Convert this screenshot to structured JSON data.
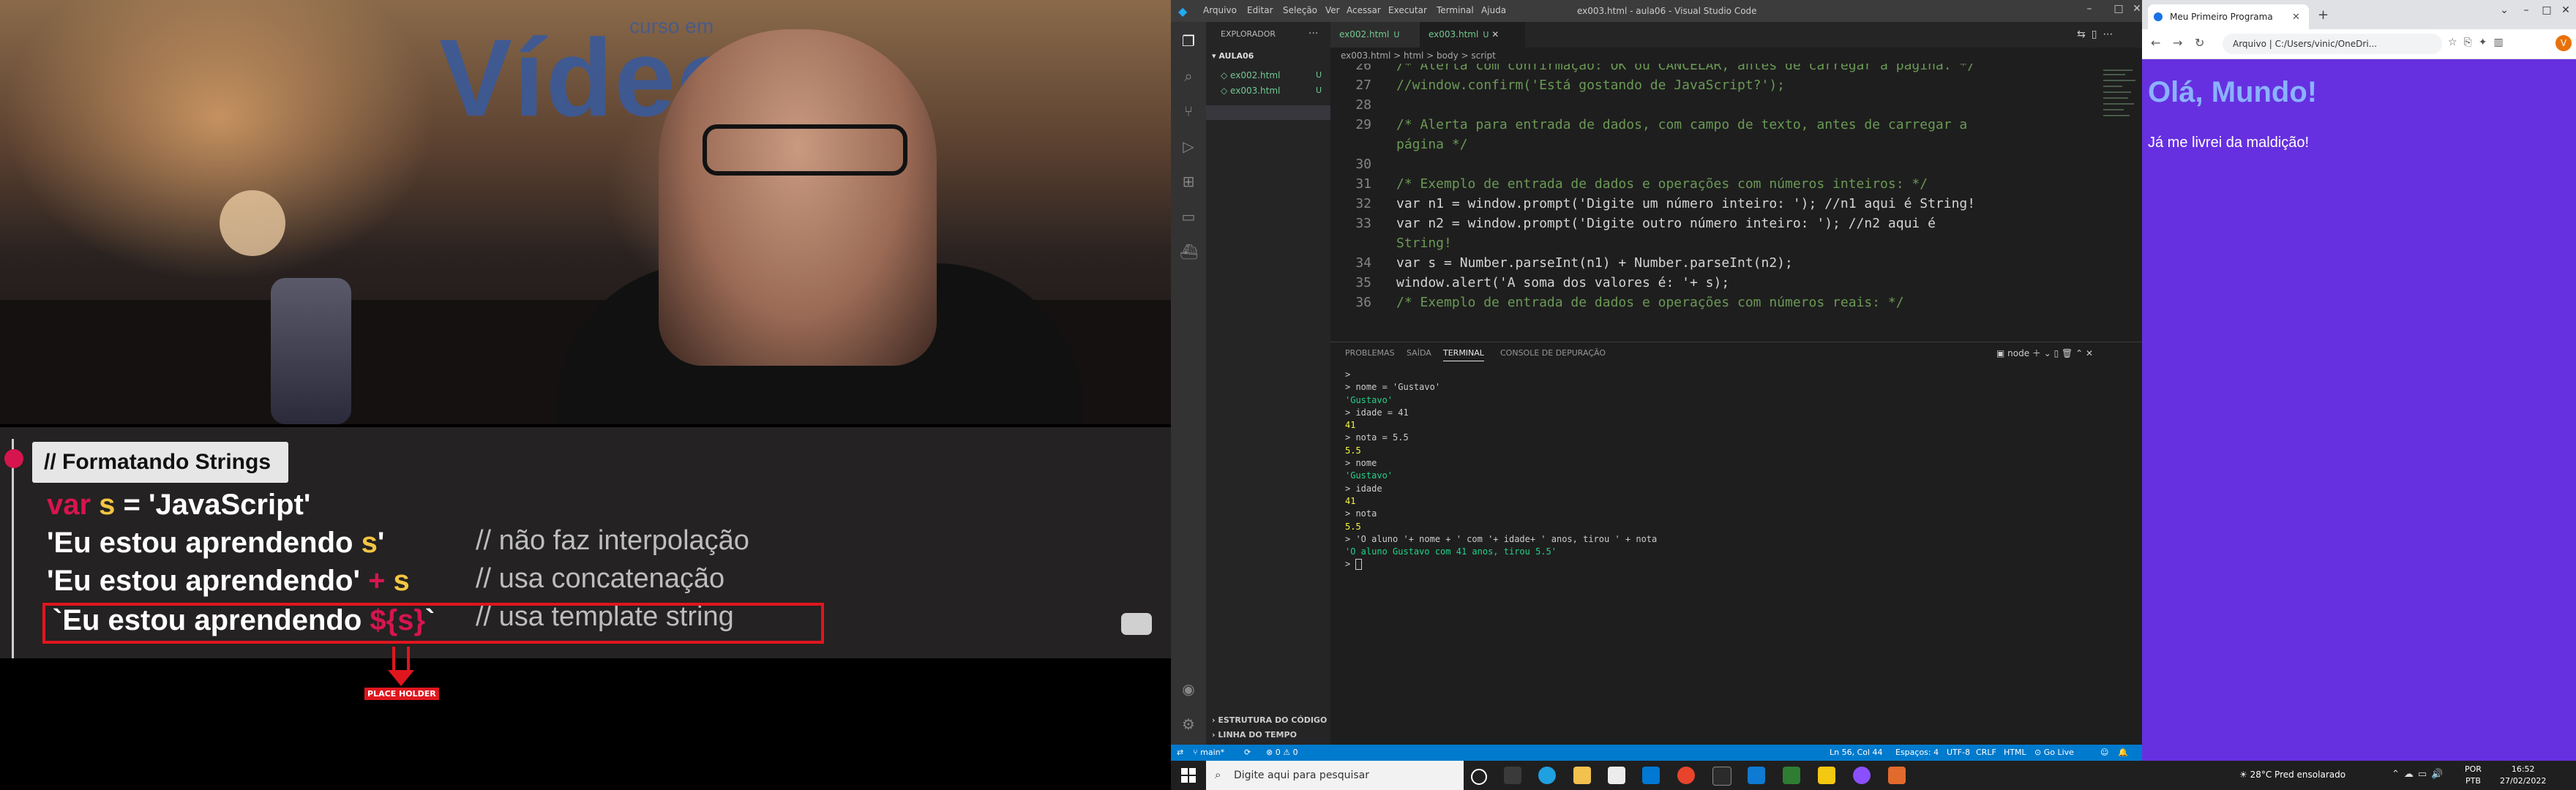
{
  "video": {
    "brand_main": "Vídeo",
    "brand_small": "curso em",
    "slide_title": "// Formatando Strings",
    "slide_lines": [
      {
        "a": "var ",
        "b": "s",
        "c": " = 'JavaScript'"
      },
      {
        "a": "'Eu estou aprendendo ",
        "b": "s",
        "c": "'"
      },
      {
        "a": "'Eu estou aprendendo' ",
        "b": "+ ",
        "c": "s"
      },
      {
        "a": "`Eu estou aprendendo ",
        "b": "${s}",
        "c": "`"
      }
    ],
    "slide_comments": [
      "// não faz interpolação",
      "// usa concatenação",
      "// usa template string"
    ],
    "annotation_label": "PLACE HOLDER"
  },
  "vscode": {
    "logo": "◆",
    "menu": [
      "Arquivo",
      "Editar",
      "Seleção",
      "Ver",
      "Acessar",
      "Executar",
      "Terminal",
      "Ajuda"
    ],
    "window_title": "ex003.html - aula06 - Visual Studio Code",
    "explorer_title": "EXPLORADOR",
    "explorer_more": "···",
    "folder": "AULA06",
    "files": [
      {
        "name": "ex002.html",
        "status": "U"
      },
      {
        "name": "ex003.html",
        "status": "U"
      }
    ],
    "outline": "ESTRUTURA DO CÓDIGO",
    "timeline": "LINHA DO TEMPO",
    "tabs": [
      {
        "name": "ex002.html",
        "status": "U"
      },
      {
        "name": "ex003.html",
        "status": "U"
      }
    ],
    "breadcrumb": "ex003.html > html > body > script",
    "line_numbers": [
      "26",
      "27",
      "",
      "28",
      "29",
      "",
      "30",
      "31",
      "32",
      "33",
      "",
      "34",
      "35",
      "36"
    ],
    "code_lines": [
      "/* Alerta com confirmação: OK ou CANCELAR, antes de carregar a página. */",
      "//window.confirm('Está gostando de JavaScript?');",
      "",
      "",
      "/* Alerta para entrada de dados, com campo de texto, antes de carregar a",
      "página */",
      "",
      "/* Exemplo de entrada de dados e operações com números inteiros: */",
      "var n1 = window.prompt('Digite um número inteiro: '); //n1 aqui é String!",
      "var n2 = window.prompt('Digite outro número inteiro: '); //n2 aqui é",
      "String!",
      "var s = Number.parseInt(n1) + Number.parseInt(n2);",
      "window.alert('A soma dos valores é: '+ s);",
      "/* Exemplo de entrada de dados e operações com números reais: */"
    ],
    "panel_tabs": [
      "PROBLEMAS",
      "SAÍDA",
      "TERMINAL",
      "CONSOLE DE DEPURAÇÃO"
    ],
    "terminal_shell": "node",
    "terminal": [
      {
        "t": "in",
        "s": ">"
      },
      {
        "t": "in",
        "s": "> nome = 'Gustavo'"
      },
      {
        "t": "str",
        "s": "'Gustavo'"
      },
      {
        "t": "in",
        "s": "> idade = 41"
      },
      {
        "t": "num",
        "s": "41"
      },
      {
        "t": "in",
        "s": "> nota = 5.5"
      },
      {
        "t": "num",
        "s": "5.5"
      },
      {
        "t": "in",
        "s": "> nome"
      },
      {
        "t": "str",
        "s": "'Gustavo'"
      },
      {
        "t": "in",
        "s": "> idade"
      },
      {
        "t": "num",
        "s": "41"
      },
      {
        "t": "in",
        "s": "> nota"
      },
      {
        "t": "num",
        "s": "5.5"
      },
      {
        "t": "in",
        "s": "> 'O aluno '+ nome + ' com '+ idade+ ' anos, tirou ' + nota"
      },
      {
        "t": "str",
        "s": "'O aluno Gustavo com 41 anos, tirou 5.5'"
      },
      {
        "t": "in",
        "s": "> "
      }
    ],
    "status": {
      "branch": "main*",
      "sync": "⟳",
      "problems": "⊗ 0 ⚠ 0",
      "position": "Ln 56, Col 44",
      "spaces": "Espaços: 4",
      "encoding": "UTF-8",
      "eol": "CRLF",
      "language": "HTML",
      "golive": "Go Live"
    }
  },
  "browser": {
    "tab_title": "Meu Primeiro Programa",
    "address": "Arquivo | C:/Users/vinic/OneDri...",
    "h1": "Olá, Mundo!",
    "p": "Já me livrei da maldição!",
    "avatar": "V"
  },
  "taskbar": {
    "search_placeholder": "Digite aqui para pesquisar",
    "weather": "28°C  Pred ensolarado",
    "lang1": "POR",
    "lang2": "PTB",
    "time": "16:52",
    "date": "27/02/2022"
  }
}
